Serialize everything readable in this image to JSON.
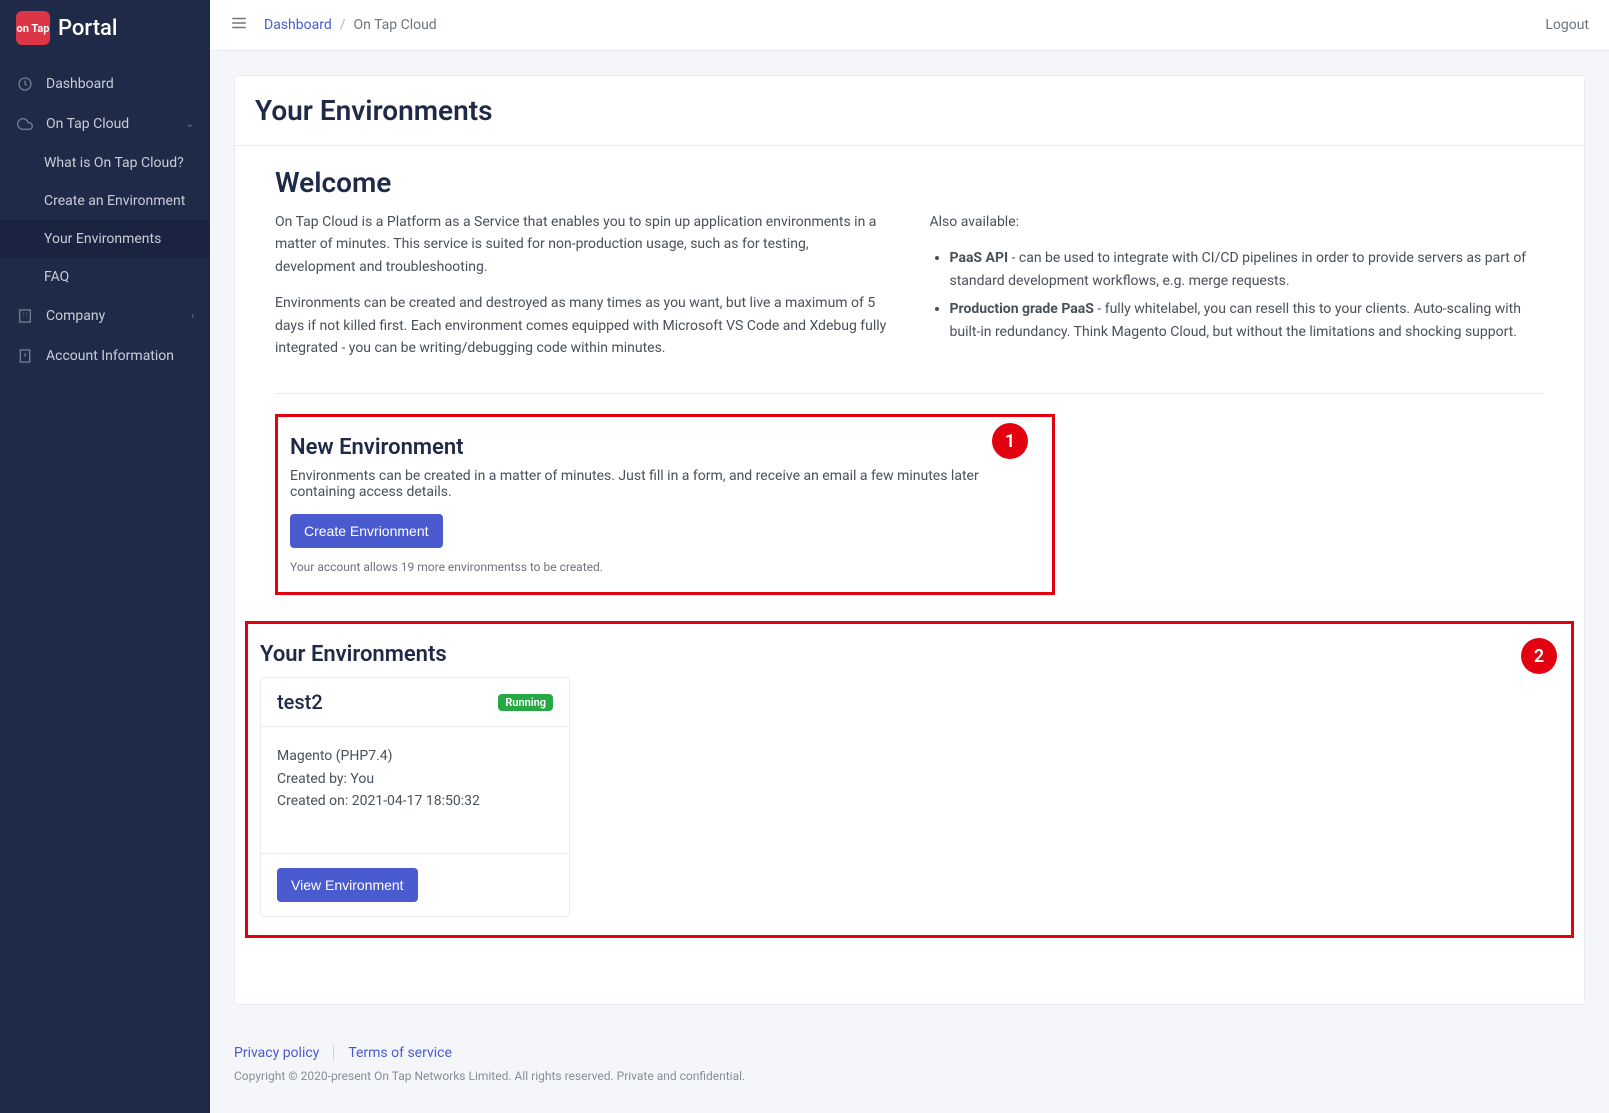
{
  "brand": {
    "logo_text": "on Tap",
    "name": "Portal"
  },
  "sidebar": {
    "items": [
      {
        "label": "Dashboard"
      },
      {
        "label": "On Tap Cloud",
        "children": [
          {
            "label": "What is On Tap Cloud?"
          },
          {
            "label": "Create an Environment"
          },
          {
            "label": "Your Environments"
          },
          {
            "label": "FAQ"
          }
        ]
      },
      {
        "label": "Company"
      },
      {
        "label": "Account Information"
      }
    ]
  },
  "topbar": {
    "breadcrumb_root": "Dashboard",
    "breadcrumb_current": "On Tap Cloud",
    "logout": "Logout"
  },
  "page": {
    "title": "Your Environments",
    "welcome_title": "Welcome",
    "welcome_p1": "On Tap Cloud is a Platform as a Service that enables you to spin up application environments in a matter of minutes. This service is suited for non-production usage, such as for testing, development and troubleshooting.",
    "welcome_p2": "Environments can be created and destroyed as many times as you want, but live a maximum of 5 days if not killed first. Each environment comes equipped with Microsoft VS Code and Xdebug fully integrated - you can be writing/debugging code within minutes.",
    "also_title": "Also available:",
    "bullet1_strong": "PaaS API",
    "bullet1_rest": " - can be used to integrate with CI/CD pipelines in order to provide servers as part of standard development workflows, e.g. merge requests.",
    "bullet2_strong": "Production grade PaaS",
    "bullet2_rest": " - fully whitelabel, you can resell this to your clients. Auto-scaling with built-in redundancy. Think Magento Cloud, but without the limitations and shocking support."
  },
  "new_env": {
    "title": "New Environment",
    "desc": "Environments can be created in a matter of minutes. Just fill in a form, and receive an email a few minutes later containing access details.",
    "button": "Create Envrionment",
    "note": "Your account allows 19 more environmentss to be created.",
    "marker": "1"
  },
  "your_envs": {
    "title": "Your Environments",
    "marker": "2",
    "items": [
      {
        "name": "test2",
        "status": "Running",
        "stack": "Magento (PHP7.4)",
        "created_by": "Created by: You",
        "created_on": "Created on: 2021-04-17 18:50:32",
        "view": "View Environment"
      }
    ]
  },
  "footer": {
    "privacy": "Privacy policy",
    "terms": "Terms of service",
    "copyright": "Copyright © 2020-present On Tap Networks Limited. All rights reserved. Private and confidential."
  }
}
